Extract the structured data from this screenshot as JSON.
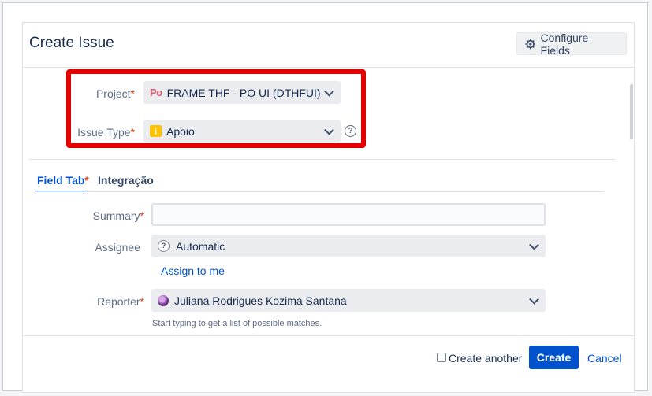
{
  "dialog": {
    "title": "Create Issue",
    "configure_fields_label": "Configure Fields"
  },
  "project": {
    "label": "Project",
    "required_mark": "*",
    "logo_text": "Po",
    "value": "FRAME THF - PO UI (DTHFUI)"
  },
  "issue_type": {
    "label": "Issue Type",
    "required_mark": "*",
    "icon_text": "i",
    "value": "Apoio",
    "help_glyph": "?"
  },
  "tabs": [
    {
      "label": "Field Tab",
      "required_mark": "*",
      "active": true
    },
    {
      "label": "Integração",
      "active": false
    }
  ],
  "summary": {
    "label": "Summary",
    "required_mark": "*",
    "value": ""
  },
  "assignee": {
    "label": "Assignee",
    "value": "Automatic",
    "icon_text": "?",
    "assign_to_me": "Assign to me"
  },
  "reporter": {
    "label": "Reporter",
    "required_mark": "*",
    "value": "Juliana Rodrigues Kozima Santana",
    "hint": "Start typing to get a list of possible matches."
  },
  "footer": {
    "create_another_label": "Create another",
    "create_another_checked": false,
    "create_label": "Create",
    "cancel_label": "Cancel"
  },
  "colors": {
    "primary": "#0052cc",
    "highlight": "#e30000",
    "required": "#de350b",
    "issue_type_icon": "#ffc400",
    "project_logo": "#e2576d"
  },
  "icons": {
    "configure": "gear-icon",
    "select_arrow": "chevron-down-icon",
    "help": "help-icon",
    "assignee": "automatic-user-icon",
    "reporter": "avatar"
  }
}
